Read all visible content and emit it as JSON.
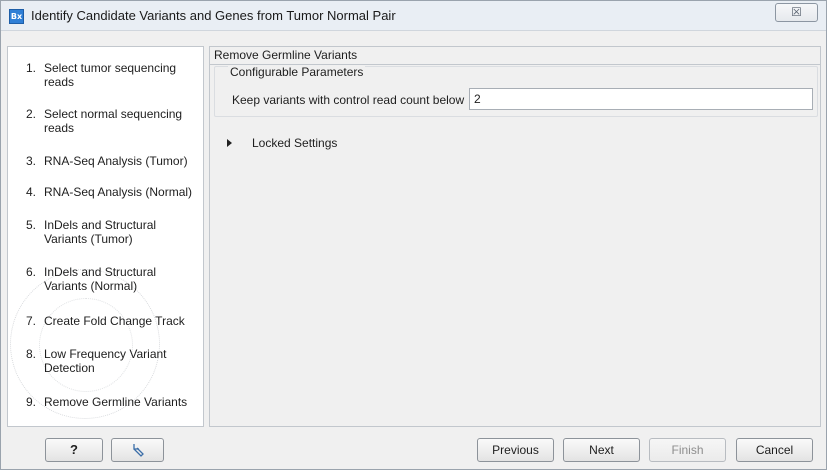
{
  "window": {
    "icon_text": "Bx",
    "title": "Identify Candidate Variants and Genes from Tumor Normal Pair",
    "close_glyph": "☒"
  },
  "sidebar": {
    "steps": [
      {
        "num": "1.",
        "label": "Select tumor sequencing reads"
      },
      {
        "num": "2.",
        "label": "Select normal sequencing reads"
      },
      {
        "num": "3.",
        "label": "RNA-Seq Analysis (Tumor)"
      },
      {
        "num": "4.",
        "label": "RNA-Seq Analysis (Normal)"
      },
      {
        "num": "5.",
        "label": "InDels and Structural Variants (Tumor)"
      },
      {
        "num": "6.",
        "label": "InDels and Structural Variants (Normal)"
      },
      {
        "num": "7.",
        "label": "Create Fold Change Track"
      },
      {
        "num": "8.",
        "label": "Low Frequency Variant Detection"
      },
      {
        "num": "9.",
        "label": "Remove Germline Variants"
      }
    ]
  },
  "main": {
    "section_title": "Remove Germline Variants",
    "group_title": "Configurable Parameters",
    "param_label": "Keep variants with control read count below",
    "param_value": "2",
    "locked_label": "Locked Settings"
  },
  "buttons": {
    "help": "?",
    "reset_icon": "reset-icon",
    "previous": "Previous",
    "next": "Next",
    "finish": "Finish",
    "cancel": "Cancel"
  }
}
